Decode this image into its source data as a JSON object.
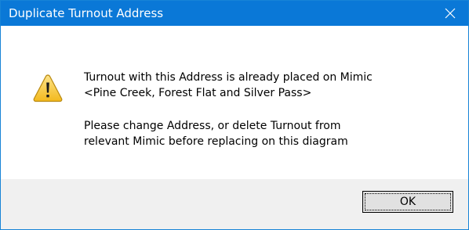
{
  "window": {
    "title": "Duplicate Turnout Address",
    "close_symbol": "✕"
  },
  "icon": "warning-icon",
  "message": {
    "line1": "Turnout with this Address is already placed on Mimic",
    "line2": "<Pine Creek, Forest Flat and Silver Pass>",
    "line3": "Please change Address, or delete Turnout from",
    "line4": "relevant Mimic before replacing on this diagram"
  },
  "buttons": {
    "ok_label": "OK"
  },
  "colors": {
    "titlebar": "#0a78d7",
    "footer": "#f0f0f0",
    "warning_fill": "#f7c72f",
    "warning_edge": "#b98910"
  }
}
